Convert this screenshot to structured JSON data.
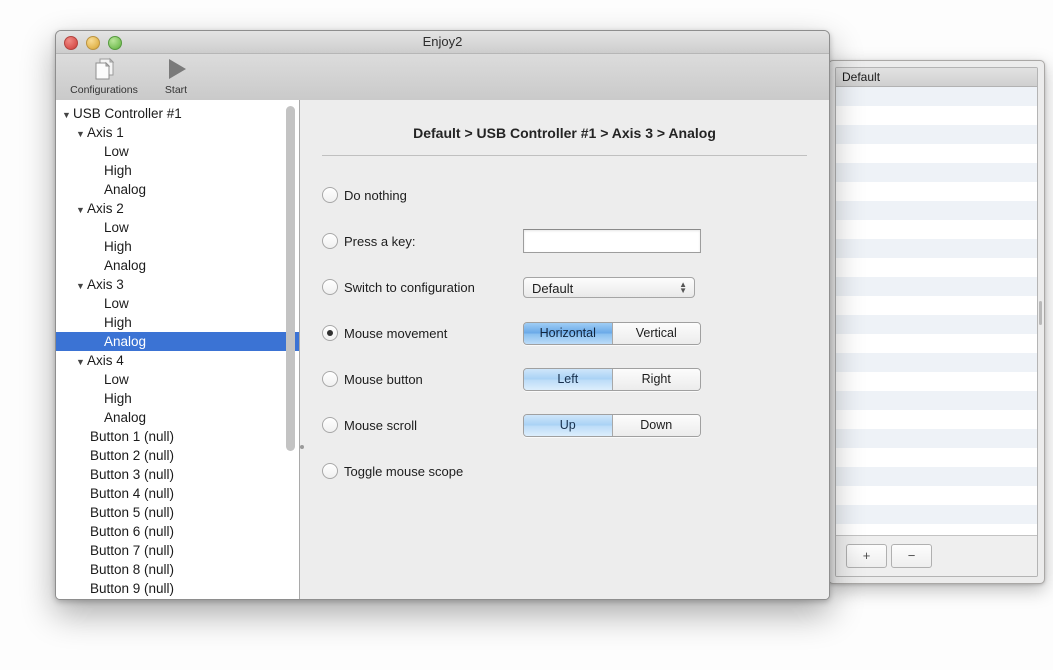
{
  "background_window": {
    "table_header": "Default",
    "row_count": 24,
    "add_button": "+",
    "remove_button": "−"
  },
  "main_window": {
    "title": "Enjoy2",
    "traffic_lights": [
      "close-button",
      "minimize-button",
      "zoom-button"
    ],
    "toolbar": {
      "items": [
        {
          "label": "Configurations",
          "icon": "documents-icon"
        },
        {
          "label": "Start",
          "icon": "play-icon"
        }
      ]
    },
    "sidebar": {
      "tree": [
        {
          "label": "USB Controller #1",
          "level": 0,
          "disclosure": "▼",
          "selected": false
        },
        {
          "label": "Axis 1",
          "level": 1,
          "disclosure": "▼",
          "selected": false
        },
        {
          "label": "Low",
          "level": 2,
          "disclosure": "",
          "selected": false
        },
        {
          "label": "High",
          "level": 2,
          "disclosure": "",
          "selected": false
        },
        {
          "label": "Analog",
          "level": 2,
          "disclosure": "",
          "selected": false
        },
        {
          "label": "Axis 2",
          "level": 1,
          "disclosure": "▼",
          "selected": false
        },
        {
          "label": "Low",
          "level": 2,
          "disclosure": "",
          "selected": false
        },
        {
          "label": "High",
          "level": 2,
          "disclosure": "",
          "selected": false
        },
        {
          "label": "Analog",
          "level": 2,
          "disclosure": "",
          "selected": false
        },
        {
          "label": "Axis 3",
          "level": 1,
          "disclosure": "▼",
          "selected": false
        },
        {
          "label": "Low",
          "level": 2,
          "disclosure": "",
          "selected": false
        },
        {
          "label": "High",
          "level": 2,
          "disclosure": "",
          "selected": false
        },
        {
          "label": "Analog",
          "level": 2,
          "disclosure": "",
          "selected": true
        },
        {
          "label": "Axis 4",
          "level": 1,
          "disclosure": "▼",
          "selected": false
        },
        {
          "label": "Low",
          "level": 2,
          "disclosure": "",
          "selected": false
        },
        {
          "label": "High",
          "level": 2,
          "disclosure": "",
          "selected": false
        },
        {
          "label": "Analog",
          "level": 2,
          "disclosure": "",
          "selected": false
        },
        {
          "label": "Button 1 (null)",
          "level": 1.5,
          "disclosure": "",
          "selected": false
        },
        {
          "label": "Button 2 (null)",
          "level": 1.5,
          "disclosure": "",
          "selected": false
        },
        {
          "label": "Button 3 (null)",
          "level": 1.5,
          "disclosure": "",
          "selected": false
        },
        {
          "label": "Button 4 (null)",
          "level": 1.5,
          "disclosure": "",
          "selected": false
        },
        {
          "label": "Button 5 (null)",
          "level": 1.5,
          "disclosure": "",
          "selected": false
        },
        {
          "label": "Button 6 (null)",
          "level": 1.5,
          "disclosure": "",
          "selected": false
        },
        {
          "label": "Button 7 (null)",
          "level": 1.5,
          "disclosure": "",
          "selected": false
        },
        {
          "label": "Button 8 (null)",
          "level": 1.5,
          "disclosure": "",
          "selected": false
        },
        {
          "label": "Button 9 (null)",
          "level": 1.5,
          "disclosure": "",
          "selected": false
        }
      ]
    },
    "detail": {
      "breadcrumb": "Default > USB Controller #1 > Axis 3 > Analog",
      "options": [
        {
          "label": "Do nothing",
          "selected": false,
          "control": "none"
        },
        {
          "label": "Press a key:",
          "selected": false,
          "control": "textfield",
          "value": "",
          "placeholder": ""
        },
        {
          "label": "Switch to configuration",
          "selected": false,
          "control": "popup",
          "value": "Default"
        },
        {
          "label": "Mouse movement",
          "selected": true,
          "control": "segmented",
          "segments": [
            {
              "text": "Horizontal",
              "selected": true
            },
            {
              "text": "Vertical",
              "selected": false
            }
          ]
        },
        {
          "label": "Mouse button",
          "selected": false,
          "control": "segmented",
          "segments": [
            {
              "text": "Left",
              "selected": true
            },
            {
              "text": "Right",
              "selected": false
            }
          ]
        },
        {
          "label": "Mouse scroll",
          "selected": false,
          "control": "segmented",
          "segments": [
            {
              "text": "Up",
              "selected": true
            },
            {
              "text": "Down",
              "selected": false
            }
          ]
        },
        {
          "label": "Toggle mouse scope",
          "selected": false,
          "control": "none"
        }
      ]
    }
  },
  "colors": {
    "selection_blue": "#3b73d4",
    "segment_selected_blue": "#6aa9e8",
    "window_chrome": "#e8e8e8"
  }
}
